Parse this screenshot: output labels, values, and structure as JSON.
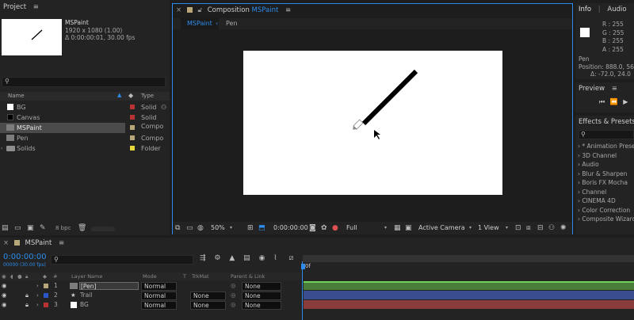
{
  "project": {
    "tab": "Project",
    "item_name": "MSPaint",
    "item_size": "1920 x 1080 (1.00)",
    "item_duration": "Δ 0:00:00:01, 30.00 fps",
    "col_name": "Name",
    "col_type": "Type",
    "bpc": "8 bpc",
    "items": [
      {
        "name": "BG",
        "type": "Solid",
        "swatch": "#ffffff",
        "label": "#b83232"
      },
      {
        "name": "Canvas",
        "type": "Solid",
        "swatch": "#000000",
        "label": "#b83232"
      },
      {
        "name": "MSPaint",
        "type": "Compo",
        "swatch": "",
        "label": "#b8a879"
      },
      {
        "name": "Pen",
        "type": "Compo",
        "swatch": "",
        "label": "#b8a879"
      },
      {
        "name": "Solids",
        "type": "Folder",
        "swatch": "",
        "label": "#e6d83a"
      }
    ]
  },
  "composition": {
    "title_prefix": "Composition",
    "title_name": "MSPaint",
    "tabs": [
      "MSPaint",
      "Pen"
    ],
    "zoom": "50%",
    "timecode": "0:00:00:00",
    "quality": "Full",
    "camera": "Active Camera",
    "views": "1 View"
  },
  "info": {
    "tab": "Info",
    "tab2": "Audio",
    "r": "R :  255",
    "g": "G :  255",
    "b": "B :  255",
    "a": "A :  255",
    "layer": "Pen",
    "position": "Position: 888.0, 564.0",
    "delta": "Δ: -72.0, 24.0"
  },
  "preview": {
    "tab": "Preview"
  },
  "effects": {
    "tab": "Effects & Presets",
    "items": [
      "* Animation Presets",
      "3D Channel",
      "Audio",
      "Blur & Sharpen",
      "Boris FX Mocha",
      "Channel",
      "CINEMA 4D",
      "Color Correction",
      "Composite Wizard"
    ]
  },
  "timeline": {
    "tab": "MSPaint",
    "timecode": "0:00:00:00",
    "frame_info": "00000 (30.00 fps)",
    "col_layer": "Layer Name",
    "col_mode": "Mode",
    "col_t": "T",
    "col_trkmat": "TrkMat",
    "col_parent": "Parent & Link",
    "ruler_start": "0f",
    "layers": [
      {
        "num": "1",
        "name": "[Pen]",
        "mode": "Normal",
        "trkmat": "",
        "parent": "None",
        "label": "#b8a879",
        "bar": "#4a7d3a"
      },
      {
        "num": "2",
        "name": "Trail",
        "mode": "Normal",
        "trkmat": "None",
        "parent": "None",
        "label": "#2a56c8",
        "bar": "#3a4d8f"
      },
      {
        "num": "3",
        "name": "BG",
        "mode": "Normal",
        "trkmat": "None",
        "parent": "None",
        "label": "#b83232",
        "bar": "#8a3c3c"
      }
    ]
  }
}
